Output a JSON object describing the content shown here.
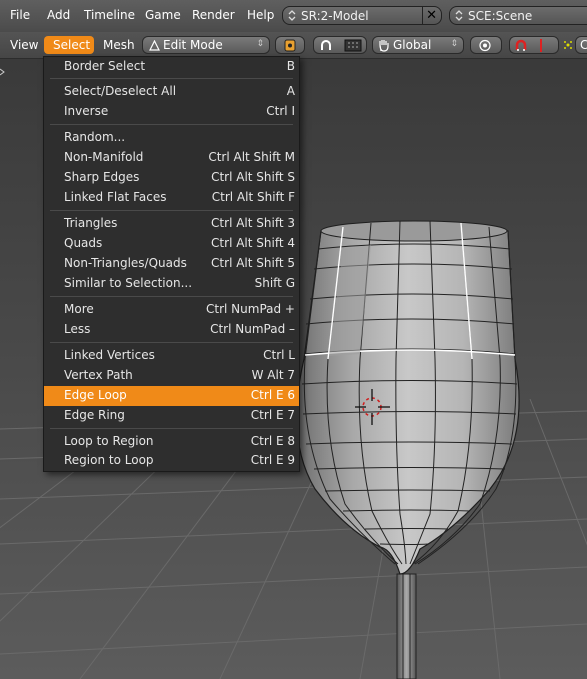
{
  "topbar": {
    "menus": [
      "File",
      "Add",
      "Timeline",
      "Game",
      "Render",
      "Help"
    ],
    "screen_field": "SR:2-Model",
    "scene_field": "SCE:Scene"
  },
  "header": {
    "view": "View",
    "select": "Select",
    "mesh": "Mesh",
    "mode": "Edit Mode",
    "orientation": "Global",
    "cut_text": "C"
  },
  "select_menu": {
    "items": [
      {
        "label": "Border Select",
        "shortcut": "B"
      },
      {
        "label": "Select/Deselect All",
        "shortcut": "A"
      },
      {
        "label": "Inverse",
        "shortcut": "Ctrl I"
      },
      {
        "label": "Random...",
        "shortcut": ""
      },
      {
        "label": "Non-Manifold",
        "shortcut": "Ctrl Alt Shift M"
      },
      {
        "label": "Sharp Edges",
        "shortcut": "Ctrl Alt Shift S"
      },
      {
        "label": "Linked Flat Faces",
        "shortcut": "Ctrl Alt Shift F"
      },
      {
        "label": "Triangles",
        "shortcut": "Ctrl Alt Shift 3"
      },
      {
        "label": "Quads",
        "shortcut": "Ctrl Alt Shift 4"
      },
      {
        "label": "Non-Triangles/Quads",
        "shortcut": "Ctrl Alt Shift 5"
      },
      {
        "label": "Similar to Selection...",
        "shortcut": "Shift G"
      },
      {
        "label": "More",
        "shortcut": "Ctrl NumPad +"
      },
      {
        "label": "Less",
        "shortcut": "Ctrl NumPad –"
      },
      {
        "label": "Linked Vertices",
        "shortcut": "Ctrl L"
      },
      {
        "label": "Vertex Path",
        "shortcut": "W Alt 7"
      },
      {
        "label": "Edge Loop",
        "shortcut": "Ctrl E 6"
      },
      {
        "label": "Edge Ring",
        "shortcut": "Ctrl E 7"
      },
      {
        "label": "Loop to Region",
        "shortcut": "Ctrl E 8"
      },
      {
        "label": "Region to Loop",
        "shortcut": "Ctrl E 9"
      }
    ]
  },
  "colors": {
    "accent": "#f08a18",
    "menu_bg": "#2e2e2e",
    "header_bg": "#4b4b4b",
    "viewport_bg": "#3d3d3d",
    "grid_line": "#555555",
    "mesh_fill": "#bdbdbd"
  },
  "icons": [
    "dropdown-icon",
    "close-icon",
    "mode-icon",
    "pivot-icon",
    "snap-magnet-icon",
    "proportional-icon",
    "hand-icon",
    "manipulator-icon",
    "layers-icon",
    "cursor-3d-icon",
    "object-mesh-icon"
  ]
}
